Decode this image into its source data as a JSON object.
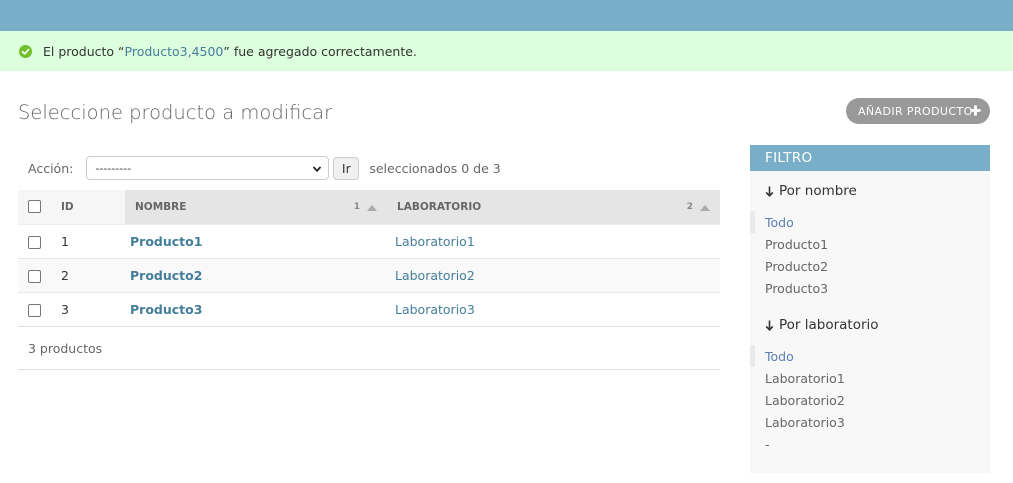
{
  "message": {
    "prefix": "El producto “",
    "link": "Producto3,4500",
    "suffix": "” fue agregado correctamente.",
    "icon": "check-circle-icon",
    "color": "#70bf2b"
  },
  "page_title": "Seleccione producto a modificar",
  "add_button": {
    "label": "AÑADIR PRODUCTO",
    "icon": "plus-icon"
  },
  "actions": {
    "label": "Acción:",
    "selected_value": "---------",
    "go_label": "Ir",
    "counter": "seleccionados 0 de 3"
  },
  "table": {
    "headers": {
      "id": "ID",
      "nombre": "NOMBRE",
      "nombre_sort_priority": "1",
      "laboratorio": "LABORATORIO",
      "laboratorio_sort_priority": "2"
    },
    "rows": [
      {
        "id": "1",
        "nombre": "Producto1",
        "laboratorio": "Laboratorio1"
      },
      {
        "id": "2",
        "nombre": "Producto2",
        "laboratorio": "Laboratorio2"
      },
      {
        "id": "3",
        "nombre": "Producto3",
        "laboratorio": "Laboratorio3"
      }
    ]
  },
  "paginator": "3 productos",
  "filter": {
    "title": "FILTRO",
    "groups": [
      {
        "title": "Por nombre",
        "items": [
          "Todo",
          "Producto1",
          "Producto2",
          "Producto3"
        ]
      },
      {
        "title": "Por laboratorio",
        "items": [
          "Todo",
          "Laboratorio1",
          "Laboratorio2",
          "Laboratorio3",
          "-"
        ]
      }
    ]
  },
  "colors": {
    "header": "#79aec8",
    "link": "#447e9b",
    "success_bg": "#ddffdd",
    "button_bg": "#999999"
  }
}
